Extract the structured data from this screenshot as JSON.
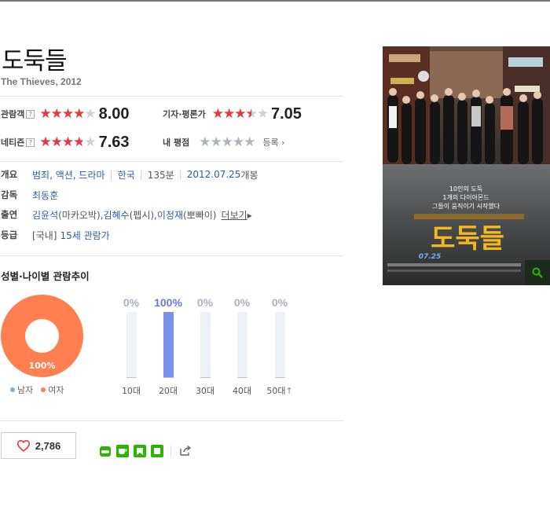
{
  "movie": {
    "title": "도둑들",
    "subtitle": "The Thieves, 2012"
  },
  "ratings": {
    "audience": {
      "label": "관람객",
      "help": "?",
      "score": "8.00",
      "fraction": 0.8
    },
    "critic": {
      "label": "기자·평론가",
      "score": "7.05",
      "fraction": 0.705
    },
    "netizen": {
      "label": "네티즌",
      "help": "?",
      "score": "7.63",
      "fraction": 0.763
    },
    "my": {
      "label": "내 평점",
      "register_label": "등록"
    }
  },
  "info": {
    "overview_label": "개요",
    "genres": "범죄, 액션, 드라마",
    "country": "한국",
    "runtime": "135분",
    "release": "2012.07.25",
    "release_suffix": "개봉",
    "director_label": "감독",
    "director": "최동훈",
    "cast_label": "출연",
    "cast": "김윤석",
    "cast_role": "(마카오박), ",
    "cast2": "김혜수",
    "cast2_role": "(펩시), ",
    "cast3": "이정재",
    "cast3_role": "(뽀빠이)",
    "more_label": "더보기",
    "grade_label": "등급",
    "grade_prefix": "[국내]",
    "grade": "15세 관람가"
  },
  "trend": {
    "title": "성별·나이별 관람추이",
    "gender": {
      "female_pct": "100%",
      "male_label": "남자",
      "female_label": "여자",
      "male_color": "#6fb4e8",
      "female_color": "#ff7f50"
    },
    "ages": [
      {
        "label": "10대",
        "pct": "0%",
        "value": 0
      },
      {
        "label": "20대",
        "pct": "100%",
        "value": 100
      },
      {
        "label": "30대",
        "pct": "0%",
        "value": 0
      },
      {
        "label": "40대",
        "pct": "0%",
        "value": 0
      },
      {
        "label": "50대",
        "pct": "0%",
        "value": 0
      }
    ]
  },
  "like": {
    "count": "2,786",
    "icon": "heart-icon"
  },
  "share_icons": [
    "band-icon",
    "cafe-icon",
    "bookmark-icon",
    "memo-icon",
    "share-out-icon"
  ],
  "poster": {
    "tagline1": "10인의 도둑",
    "tagline2": "1개의 다이아몬드",
    "tagline3": "그들이 움직이기 시작했다",
    "title": "도둑들",
    "date": "07.25"
  },
  "colors": {
    "accent_red": "#e8373f",
    "link_blue": "#2d5da1",
    "bar_blue": "#7792e8",
    "naver_green": "#2db400"
  }
}
